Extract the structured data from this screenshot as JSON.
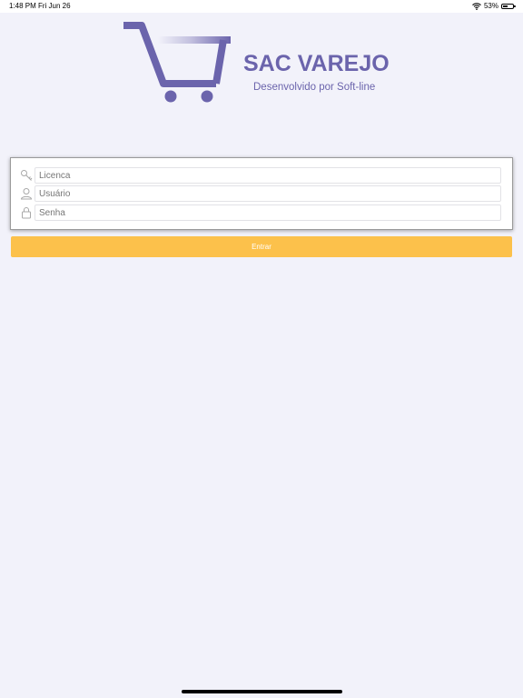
{
  "status_bar": {
    "time": "1:48 PM",
    "date": "Fri Jun 26",
    "battery_text": "53%",
    "battery_level": 0.53
  },
  "logo": {
    "title": "SAC VAREJO",
    "subtitle": "Desenvolvido por Soft-line",
    "icon": "shopping-cart-icon",
    "color": "#6b64ac"
  },
  "form": {
    "license_placeholder": "Licenca",
    "user_placeholder": "Usuário",
    "password_placeholder": "Senha",
    "icons": [
      "key-icon",
      "user-icon",
      "lock-icon"
    ]
  },
  "actions": {
    "enter_label": "Entrar",
    "enter_color": "#fcc14b"
  }
}
